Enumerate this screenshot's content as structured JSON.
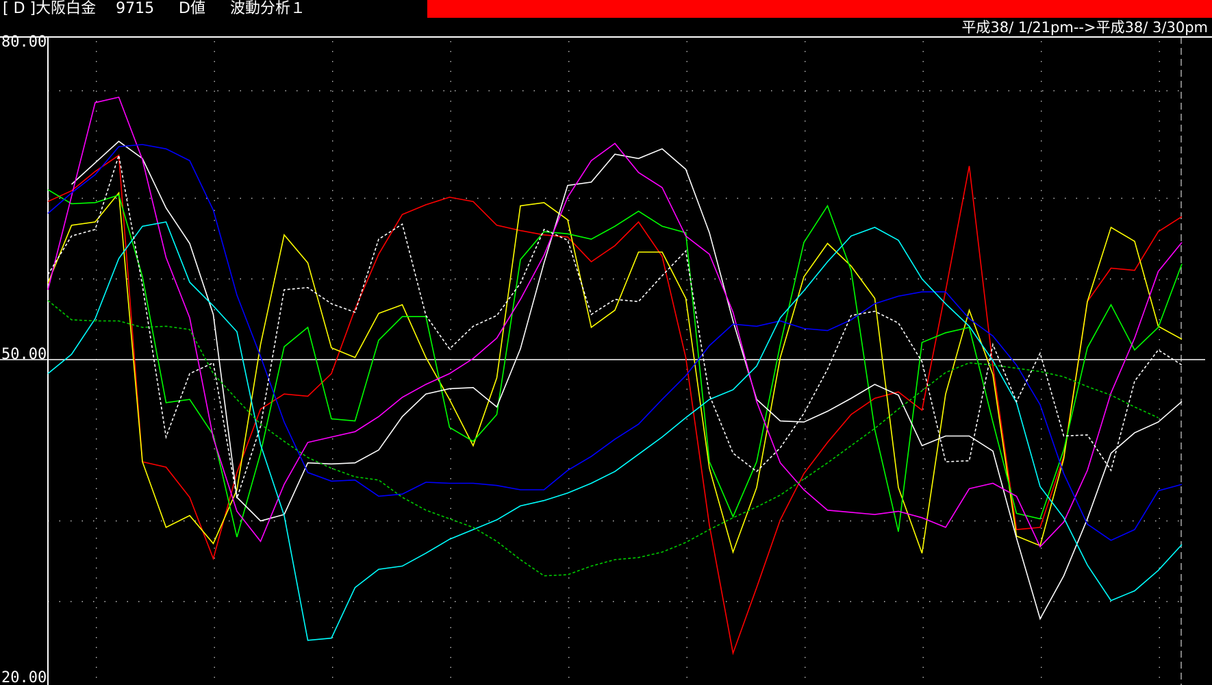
{
  "header": {
    "title": "[ D ]大阪白金　 9715 　 D値 　 波動分析１",
    "accent_color": "#ff0000"
  },
  "range_label": "平成38/ 1/21pm-->平成38/ 3/30pm",
  "chart_data": {
    "type": "line",
    "ylim": [
      20,
      80
    ],
    "yticks": [
      "80.00",
      "50.00",
      "20.00"
    ],
    "reference_line": 50,
    "x": [
      0,
      1,
      2,
      3,
      4,
      5,
      6,
      7,
      8,
      9,
      10,
      11,
      12,
      13,
      14,
      15,
      16,
      17,
      18,
      19,
      20,
      21,
      22,
      23,
      24,
      25,
      26,
      27,
      28,
      29,
      30,
      31,
      32,
      33,
      34,
      35,
      36,
      37,
      38,
      39,
      40,
      41,
      42,
      43,
      44,
      45,
      46,
      47,
      48,
      49
    ],
    "series": [
      {
        "color": "#ff0000",
        "style": "solid",
        "values": [
          64.7,
          65.7,
          67.5,
          69.0,
          40.5,
          40.0,
          37.2,
          31.5,
          39.5,
          45.4,
          46.8,
          46.6,
          48.7,
          54.7,
          59.8,
          63.5,
          64.4,
          65.1,
          64.7,
          62.5,
          62.0,
          61.6,
          61.4,
          59.1,
          60.6,
          62.8,
          59.6,
          50.2,
          34.6,
          22.7,
          28.8,
          35.1,
          39.4,
          42.3,
          44.9,
          46.4,
          47.0,
          45.3,
          56.4,
          68.0,
          49.4,
          34.2,
          34.4,
          41.0,
          55.4,
          58.5,
          58.3,
          61.9,
          63.3,
          null
        ]
      },
      {
        "color": "#ffff00",
        "style": "solid",
        "values": [
          57.1,
          62.5,
          62.8,
          65.5,
          40.5,
          34.4,
          35.5,
          32.9,
          37.9,
          51.4,
          61.6,
          59.0,
          51.1,
          50.2,
          54.3,
          55.1,
          50.2,
          46.3,
          42.0,
          48.3,
          64.3,
          64.6,
          63.0,
          53.0,
          54.6,
          60.0,
          60.0,
          55.7,
          39.9,
          32.1,
          38.1,
          50.2,
          57.7,
          60.8,
          58.7,
          55.7,
          38.1,
          32.0,
          46.8,
          54.6,
          48.6,
          33.6,
          32.7,
          40.8,
          55.4,
          62.3,
          61.0,
          53.1,
          51.9,
          null
        ]
      },
      {
        "color": "#00ff00",
        "style": "solid",
        "values": [
          65.8,
          64.5,
          64.6,
          65.3,
          57.7,
          46.0,
          46.3,
          43.0,
          33.5,
          41.3,
          51.2,
          53.0,
          44.5,
          44.3,
          51.8,
          54.0,
          54.0,
          43.7,
          42.4,
          44.9,
          59.3,
          61.9,
          61.7,
          61.2,
          62.4,
          63.8,
          62.4,
          61.8,
          40.5,
          35.4,
          40.5,
          51.4,
          60.9,
          64.3,
          58.3,
          43.5,
          34.0,
          51.6,
          52.5,
          53.0,
          44.2,
          35.7,
          35.2,
          41.6,
          51.1,
          55.1,
          50.9,
          53.0,
          58.9,
          null
        ]
      },
      {
        "color": "#ffffff",
        "style": "solid",
        "values": [
          null,
          66.3,
          68.3,
          70.3,
          68.7,
          64.1,
          60.8,
          54.2,
          37.2,
          35.0,
          35.6,
          40.4,
          40.3,
          40.4,
          41.6,
          44.7,
          46.8,
          47.3,
          47.4,
          45.6,
          51.0,
          59.0,
          66.2,
          66.5,
          69.1,
          68.7,
          69.6,
          67.7,
          61.8,
          53.6,
          46.3,
          44.3,
          44.2,
          45.2,
          46.4,
          47.7,
          46.7,
          42.0,
          42.9,
          42.9,
          41.5,
          33.4,
          25.9,
          29.9,
          35.2,
          41.3,
          43.2,
          44.2,
          46.1,
          null
        ]
      },
      {
        "color": "#ff00ff",
        "style": "solid",
        "values": [
          56.5,
          65.2,
          73.9,
          74.4,
          68.6,
          59.5,
          53.9,
          42.7,
          35.9,
          33.1,
          38.4,
          42.3,
          42.8,
          43.3,
          44.7,
          46.5,
          47.7,
          48.7,
          50.1,
          52.0,
          55.6,
          59.7,
          65.1,
          68.5,
          70.1,
          67.4,
          66.0,
          61.5,
          59.8,
          54.4,
          46.1,
          40.4,
          37.9,
          36.0,
          35.8,
          35.6,
          35.9,
          35.3,
          34.4,
          38.0,
          38.5,
          37.3,
          32.6,
          34.9,
          39.7,
          46.9,
          52.0,
          58.2,
          60.9,
          null
        ]
      },
      {
        "color": "#0000ff",
        "style": "solid",
        "values": [
          63.6,
          65.5,
          67.2,
          69.8,
          70.0,
          69.6,
          68.5,
          63.9,
          56.0,
          50.3,
          44.2,
          39.5,
          38.7,
          38.8,
          37.3,
          37.5,
          38.6,
          38.5,
          38.5,
          38.3,
          37.9,
          37.9,
          39.7,
          41.0,
          42.6,
          44.0,
          46.3,
          48.5,
          51.3,
          53.3,
          53.1,
          53.6,
          52.9,
          52.7,
          53.7,
          55.2,
          55.9,
          56.3,
          56.3,
          53.8,
          52.2,
          49.5,
          45.8,
          39.4,
          34.7,
          33.2,
          34.2,
          37.8,
          38.4,
          null
        ]
      },
      {
        "color": "#00ffff",
        "style": "solid",
        "values": [
          48.7,
          50.5,
          53.8,
          59.4,
          62.4,
          62.8,
          57.2,
          55.0,
          52.6,
          42.1,
          35.5,
          23.9,
          24.1,
          28.8,
          30.5,
          30.8,
          32.0,
          33.3,
          34.2,
          35.1,
          36.4,
          36.9,
          37.6,
          38.5,
          39.6,
          41.2,
          42.8,
          44.6,
          46.3,
          47.2,
          49.4,
          53.9,
          56.4,
          59.1,
          61.5,
          62.3,
          61.1,
          57.5,
          55.2,
          53.1,
          49.9,
          46.0,
          38.2,
          35.3,
          30.9,
          27.6,
          28.5,
          30.4,
          32.8,
          null
        ]
      },
      {
        "color": "#ffffff",
        "style": "dash",
        "values": [
          57.9,
          61.5,
          62.1,
          69.0,
          56.9,
          42.8,
          48.7,
          49.7,
          37.1,
          43.8,
          56.5,
          56.7,
          55.2,
          54.4,
          61.2,
          62.6,
          54.1,
          51.0,
          53.1,
          54.1,
          57.1,
          62.1,
          61.1,
          54.2,
          55.6,
          55.4,
          57.8,
          60.1,
          46.7,
          41.3,
          39.6,
          41.8,
          45.0,
          49.1,
          54.1,
          54.5,
          53.4,
          49.8,
          40.5,
          40.6,
          51.4,
          46.1,
          50.6,
          42.9,
          43.0,
          39.7,
          48.0,
          50.9,
          49.5,
          null
        ]
      },
      {
        "color": "#00cc00",
        "style": "dash",
        "values": [
          55.5,
          53.7,
          53.6,
          53.6,
          53.0,
          53.1,
          52.8,
          48.7,
          46.3,
          44.0,
          42.4,
          40.9,
          39.9,
          39.1,
          38.8,
          37.2,
          36.0,
          35.2,
          34.4,
          33.1,
          31.4,
          29.9,
          30.0,
          30.8,
          31.4,
          31.6,
          32.1,
          33.0,
          34.2,
          35.3,
          36.3,
          37.4,
          38.9,
          40.4,
          42.0,
          43.6,
          45.4,
          47.1,
          48.8,
          49.7,
          49.5,
          49.2,
          48.9,
          48.4,
          47.5,
          46.7,
          45.6,
          44.6,
          null,
          null
        ]
      }
    ]
  }
}
